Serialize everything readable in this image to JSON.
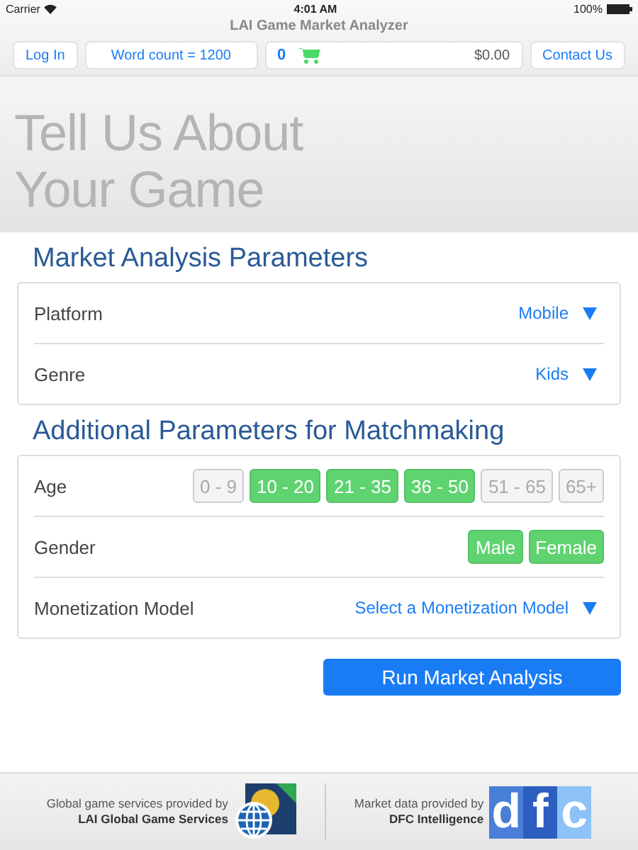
{
  "status_bar": {
    "carrier": "Carrier",
    "time": "4:01 AM",
    "battery": "100%"
  },
  "app_title": "LAI Game Market Analyzer",
  "toolbar": {
    "login": "Log In",
    "word_count": "Word count = 1200",
    "cart_count": "0",
    "cart_total": "$0.00",
    "contact": "Contact Us"
  },
  "hero_title": [
    "Tell Us About",
    "Your Game"
  ],
  "market_section": {
    "heading": "Market Analysis Parameters",
    "rows": [
      {
        "label": "Platform",
        "value": "Mobile"
      },
      {
        "label": "Genre",
        "value": "Kids"
      }
    ]
  },
  "matchmaking_section": {
    "heading": "Additional Parameters for Matchmaking",
    "rows": [
      {
        "kind": "toggles",
        "label": "Age",
        "options": [
          {
            "label": "0 - 9",
            "selected": false
          },
          {
            "label": "10 - 20",
            "selected": true
          },
          {
            "label": "21 - 35",
            "selected": true
          },
          {
            "label": "36 - 50",
            "selected": true
          },
          {
            "label": "51 - 65",
            "selected": false
          },
          {
            "label": "65+",
            "selected": false
          }
        ]
      },
      {
        "kind": "toggles",
        "label": "Gender",
        "options": [
          {
            "label": "Male",
            "selected": true
          },
          {
            "label": "Female",
            "selected": true
          }
        ]
      },
      {
        "kind": "dropdown",
        "label": "Monetization Model",
        "value": "Select a Monetization Model"
      }
    ]
  },
  "run_button": "Run Market Analysis",
  "footer": {
    "left": {
      "line1": "Global game services provided by",
      "line2": "LAI Global Game Services"
    },
    "right": {
      "line1": "Market data provided by",
      "line2": "DFC Intelligence",
      "logo_letters": [
        "d",
        "f",
        "c"
      ]
    }
  }
}
